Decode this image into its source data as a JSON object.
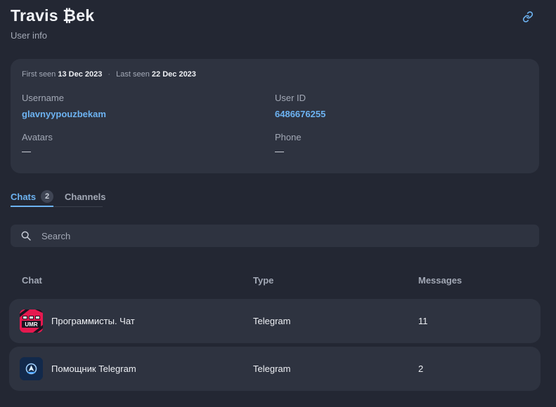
{
  "header": {
    "title": "Travis ₿ek",
    "subtitle": "User info",
    "link_icon": "link-icon"
  },
  "user": {
    "first_seen_label": "First seen",
    "first_seen": "13 Dec 2023",
    "separator": "·",
    "last_seen_label": "Last seen",
    "last_seen": "22 Dec 2023",
    "username_label": "Username",
    "username": "glavnyypouzbekam",
    "user_id_label": "User ID",
    "user_id": "6486676255",
    "avatars_label": "Avatars",
    "avatars": "—",
    "phone_label": "Phone",
    "phone": "—"
  },
  "tabs": [
    {
      "label": "Chats",
      "count": "2",
      "active": true
    },
    {
      "label": "Channels",
      "active": false
    }
  ],
  "search": {
    "placeholder": "Search",
    "value": ""
  },
  "table": {
    "columns": [
      "Chat",
      "Type",
      "Messages"
    ],
    "rows": [
      {
        "avatar_text": "UMR",
        "name": "Программисты. Чат",
        "type": "Telegram",
        "messages": "11"
      },
      {
        "avatar_icon": "telegram-helper-icon",
        "name": "Помощник Telegram",
        "type": "Telegram",
        "messages": "2"
      }
    ]
  },
  "colors": {
    "background": "#232733",
    "card": "#2e3340",
    "accent": "#6db3f2",
    "muted": "#a3a9b6"
  }
}
